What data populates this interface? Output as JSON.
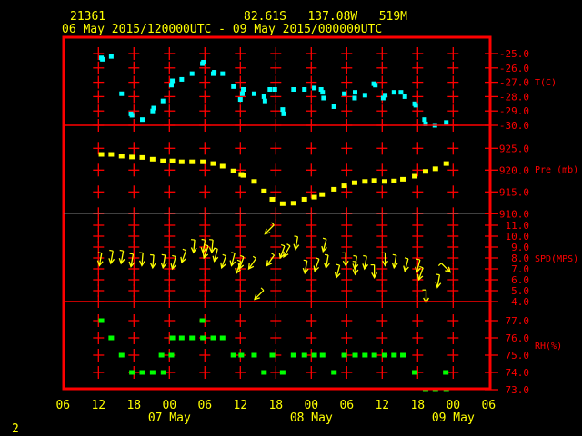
{
  "header": {
    "station_id": "21361",
    "location": "82.61S   137.08W   519M",
    "period": "06 May 2015/120000UTC - 09 May 2015/000000UTC"
  },
  "footer": {
    "page_number": "2"
  },
  "colors": {
    "frame": "#ff0000",
    "text": "#ffff00",
    "temperature": "#00ffff",
    "pressure": "#ffff00",
    "wind": "#ffff00",
    "humidity": "#00ff00"
  },
  "chart_data": {
    "type": "scatter",
    "x_axis": {
      "range": [
        "2015-05-06T06:00",
        "2015-05-09T06:00"
      ],
      "hour_ticks": [
        "06",
        "12",
        "18",
        "00",
        "06",
        "12",
        "18",
        "00",
        "06",
        "12",
        "18",
        "00",
        "06"
      ],
      "day_labels": [
        {
          "t": "2015-05-07T00:00",
          "label": "07 May"
        },
        {
          "t": "2015-05-08T00:00",
          "label": "08 May"
        },
        {
          "t": "2015-05-09T00:00",
          "label": "09 May"
        }
      ]
    },
    "panels": [
      {
        "key": "temperature",
        "label": "T(C)",
        "ticks": [
          "-25.0",
          "-26.0",
          "-27.0",
          "-28.0",
          "-29.0",
          "-30.0"
        ],
        "ylim": [
          -30,
          -25
        ],
        "points": [
          [
            "2015-05-06T12:30",
            -25.3
          ],
          [
            "2015-05-06T12:40",
            -25.4
          ],
          [
            "2015-05-06T14:10",
            -25.2
          ],
          [
            "2015-05-06T15:55",
            -27.8
          ],
          [
            "2015-05-06T17:30",
            -29.2
          ],
          [
            "2015-05-06T17:40",
            -29.3
          ],
          [
            "2015-05-06T19:25",
            -29.6
          ],
          [
            "2015-05-06T21:10",
            -29.0
          ],
          [
            "2015-05-06T21:20",
            -28.8
          ],
          [
            "2015-05-06T22:55",
            -28.3
          ],
          [
            "2015-05-07T00:30",
            -26.9
          ],
          [
            "2015-05-07T00:20",
            -27.2
          ],
          [
            "2015-05-07T02:05",
            -26.8
          ],
          [
            "2015-05-07T03:50",
            -26.4
          ],
          [
            "2015-05-07T05:35",
            -25.7
          ],
          [
            "2015-05-07T05:45",
            -25.6
          ],
          [
            "2015-05-07T07:25",
            -26.4
          ],
          [
            "2015-05-07T07:35",
            -26.3
          ],
          [
            "2015-05-07T09:00",
            -26.4
          ],
          [
            "2015-05-07T10:50",
            -27.3
          ],
          [
            "2015-05-07T12:30",
            -27.5
          ],
          [
            "2015-05-07T12:20",
            -27.8
          ],
          [
            "2015-05-07T12:00",
            -28.2
          ],
          [
            "2015-05-07T14:20",
            -27.8
          ],
          [
            "2015-05-07T16:00",
            -28.0
          ],
          [
            "2015-05-07T16:10",
            -28.3
          ],
          [
            "2015-05-07T17:00",
            -27.5
          ],
          [
            "2015-05-07T17:50",
            -27.5
          ],
          [
            "2015-05-07T19:10",
            -28.9
          ],
          [
            "2015-05-07T19:20",
            -29.2
          ],
          [
            "2015-05-07T21:00",
            -27.5
          ],
          [
            "2015-05-07T22:50",
            -27.5
          ],
          [
            "2015-05-08T00:30",
            -27.4
          ],
          [
            "2015-05-08T01:40",
            -27.5
          ],
          [
            "2015-05-08T01:55",
            -27.7
          ],
          [
            "2015-05-08T02:05",
            -28.1
          ],
          [
            "2015-05-08T03:50",
            -28.7
          ],
          [
            "2015-05-08T05:35",
            -27.8
          ],
          [
            "2015-05-08T07:25",
            -27.7
          ],
          [
            "2015-05-08T07:20",
            -28.1
          ],
          [
            "2015-05-08T09:05",
            -27.9
          ],
          [
            "2015-05-08T10:35",
            -27.1
          ],
          [
            "2015-05-08T10:50",
            -27.2
          ],
          [
            "2015-05-08T12:30",
            -27.9
          ],
          [
            "2015-05-08T12:10",
            -28.1
          ],
          [
            "2015-05-08T14:00",
            -27.7
          ],
          [
            "2015-05-08T15:10",
            -27.7
          ],
          [
            "2015-05-08T15:50",
            -28.0
          ],
          [
            "2015-05-08T17:30",
            -28.5
          ],
          [
            "2015-05-08T17:40",
            -28.6
          ],
          [
            "2015-05-08T19:10",
            -29.6
          ],
          [
            "2015-05-08T19:20",
            -29.9
          ],
          [
            "2015-05-08T20:55",
            -30.0
          ],
          [
            "2015-05-08T22:50",
            -29.8
          ]
        ]
      },
      {
        "key": "pressure",
        "label": "Pre (mb)",
        "ticks": [
          "925.0",
          "920.0",
          "915.0",
          "910.0"
        ],
        "ylim": [
          910,
          925
        ],
        "points": [
          [
            "2015-05-06T12:30",
            923.6
          ],
          [
            "2015-05-06T14:10",
            923.6
          ],
          [
            "2015-05-06T15:55",
            923.2
          ],
          [
            "2015-05-06T17:40",
            923.0
          ],
          [
            "2015-05-06T19:25",
            922.9
          ],
          [
            "2015-05-06T21:10",
            922.5
          ],
          [
            "2015-05-06T22:55",
            922.1
          ],
          [
            "2015-05-07T00:30",
            922.1
          ],
          [
            "2015-05-07T02:05",
            921.9
          ],
          [
            "2015-05-07T03:50",
            921.9
          ],
          [
            "2015-05-07T05:40",
            921.9
          ],
          [
            "2015-05-07T07:25",
            921.5
          ],
          [
            "2015-05-07T09:00",
            920.9
          ],
          [
            "2015-05-07T10:50",
            919.8
          ],
          [
            "2015-05-07T12:10",
            919.0
          ],
          [
            "2015-05-07T12:30",
            918.8
          ],
          [
            "2015-05-07T14:20",
            917.4
          ],
          [
            "2015-05-07T16:00",
            915.2
          ],
          [
            "2015-05-07T17:25",
            913.3
          ],
          [
            "2015-05-07T19:10",
            912.3
          ],
          [
            "2015-05-07T21:00",
            912.4
          ],
          [
            "2015-05-07T22:50",
            913.3
          ],
          [
            "2015-05-08T00:30",
            913.8
          ],
          [
            "2015-05-08T01:50",
            914.4
          ],
          [
            "2015-05-08T03:50",
            915.6
          ],
          [
            "2015-05-08T05:35",
            916.4
          ],
          [
            "2015-05-08T07:20",
            917.1
          ],
          [
            "2015-05-08T09:05",
            917.4
          ],
          [
            "2015-05-08T10:40",
            917.6
          ],
          [
            "2015-05-08T12:25",
            917.4
          ],
          [
            "2015-05-08T14:00",
            917.5
          ],
          [
            "2015-05-08T15:30",
            917.9
          ],
          [
            "2015-05-08T17:30",
            918.6
          ],
          [
            "2015-05-08T19:20",
            919.7
          ],
          [
            "2015-05-08T21:00",
            920.3
          ],
          [
            "2015-05-08T22:50",
            921.5
          ]
        ]
      },
      {
        "key": "wind",
        "label": "SPD(MPS)",
        "ticks": [
          "11.0",
          "10.0",
          "9.0",
          "8.0",
          "7.0",
          "6.0",
          "5.0",
          "4.0"
        ],
        "ylim": [
          4,
          11
        ],
        "point_format": [
          "time",
          "speed",
          "arrow_bearing_deg"
        ],
        "points": [
          [
            "2015-05-06T12:10",
            7.3,
            190
          ],
          [
            "2015-05-06T14:05",
            7.5,
            190
          ],
          [
            "2015-05-06T15:50",
            7.5,
            190
          ],
          [
            "2015-05-06T17:30",
            7.2,
            190
          ],
          [
            "2015-05-06T19:20",
            7.3,
            185
          ],
          [
            "2015-05-06T21:10",
            7.1,
            185
          ],
          [
            "2015-05-06T22:55",
            7.1,
            190
          ],
          [
            "2015-05-07T00:30",
            7.0,
            195
          ],
          [
            "2015-05-07T02:05",
            7.6,
            200
          ],
          [
            "2015-05-07T04:05",
            8.5,
            185
          ],
          [
            "2015-05-07T05:40",
            8.5,
            190
          ],
          [
            "2015-05-07T05:50",
            8.0,
            200
          ],
          [
            "2015-05-07T07:10",
            8.5,
            185
          ],
          [
            "2015-05-07T07:35",
            7.7,
            195
          ],
          [
            "2015-05-07T08:50",
            7.1,
            200
          ],
          [
            "2015-05-07T10:30",
            7.3,
            195
          ],
          [
            "2015-05-07T11:20",
            6.6,
            200
          ],
          [
            "2015-05-07T11:50",
            7.0,
            200
          ],
          [
            "2015-05-07T13:25",
            7.0,
            215
          ],
          [
            "2015-05-07T14:25",
            4.2,
            225
          ],
          [
            "2015-05-07T16:10",
            10.2,
            225
          ],
          [
            "2015-05-07T16:30",
            7.3,
            215
          ],
          [
            "2015-05-07T18:45",
            8.0,
            200
          ],
          [
            "2015-05-07T19:20",
            8.1,
            210
          ],
          [
            "2015-05-07T21:20",
            8.8,
            190
          ],
          [
            "2015-05-07T22:55",
            6.6,
            190
          ],
          [
            "2015-05-08T00:35",
            6.8,
            200
          ],
          [
            "2015-05-08T02:00",
            8.6,
            195
          ],
          [
            "2015-05-08T02:30",
            7.1,
            190
          ],
          [
            "2015-05-08T04:15",
            6.2,
            195
          ],
          [
            "2015-05-08T05:50",
            7.3,
            180
          ],
          [
            "2015-05-08T07:20",
            7.0,
            190
          ],
          [
            "2015-05-08T07:25",
            6.5,
            185
          ],
          [
            "2015-05-08T09:00",
            7.0,
            190
          ],
          [
            "2015-05-08T10:40",
            6.2,
            180
          ],
          [
            "2015-05-08T12:30",
            7.3,
            180
          ],
          [
            "2015-05-08T14:00",
            7.1,
            190
          ],
          [
            "2015-05-08T15:50",
            6.8,
            195
          ],
          [
            "2015-05-08T17:50",
            6.7,
            195
          ],
          [
            "2015-05-08T18:10",
            6.0,
            200
          ],
          [
            "2015-05-08T19:25",
            3.9,
            180
          ],
          [
            "2015-05-08T21:20",
            5.3,
            190
          ],
          [
            "2015-05-08T23:30",
            6.7,
            135
          ]
        ]
      },
      {
        "key": "humidity",
        "label": "RH(%)",
        "ticks": [
          "77.0",
          "76.0",
          "75.0",
          "74.0",
          "73.0"
        ],
        "ylim": [
          73,
          77
        ],
        "points": [
          [
            "2015-05-06T12:30",
            77
          ],
          [
            "2015-05-06T14:10",
            76
          ],
          [
            "2015-05-06T15:55",
            75
          ],
          [
            "2015-05-06T17:40",
            74
          ],
          [
            "2015-05-06T19:25",
            74
          ],
          [
            "2015-05-06T21:10",
            74
          ],
          [
            "2015-05-06T22:40",
            75
          ],
          [
            "2015-05-06T23:00",
            74
          ],
          [
            "2015-05-07T00:20",
            75
          ],
          [
            "2015-05-07T00:30",
            76
          ],
          [
            "2015-05-07T02:05",
            76
          ],
          [
            "2015-05-07T03:50",
            76
          ],
          [
            "2015-05-07T05:35",
            77
          ],
          [
            "2015-05-07T05:40",
            76
          ],
          [
            "2015-05-07T07:25",
            76
          ],
          [
            "2015-05-07T09:00",
            76
          ],
          [
            "2015-05-07T10:50",
            75
          ],
          [
            "2015-05-07T12:10",
            75
          ],
          [
            "2015-05-07T14:20",
            75
          ],
          [
            "2015-05-07T16:00",
            74
          ],
          [
            "2015-05-07T17:25",
            75
          ],
          [
            "2015-05-07T19:10",
            74
          ],
          [
            "2015-05-07T21:00",
            75
          ],
          [
            "2015-05-07T22:50",
            75
          ],
          [
            "2015-05-08T00:30",
            75
          ],
          [
            "2015-05-08T01:55",
            75
          ],
          [
            "2015-05-08T03:50",
            74
          ],
          [
            "2015-05-08T05:35",
            75
          ],
          [
            "2015-05-08T07:25",
            75
          ],
          [
            "2015-05-08T09:05",
            75
          ],
          [
            "2015-05-08T10:40",
            75
          ],
          [
            "2015-05-08T12:25",
            75
          ],
          [
            "2015-05-08T14:00",
            75
          ],
          [
            "2015-05-08T15:30",
            75
          ],
          [
            "2015-05-08T17:30",
            74
          ],
          [
            "2015-05-08T19:20",
            73
          ],
          [
            "2015-05-08T21:00",
            73
          ],
          [
            "2015-05-08T22:45",
            74
          ],
          [
            "2015-05-08T22:50",
            73
          ]
        ]
      }
    ]
  }
}
